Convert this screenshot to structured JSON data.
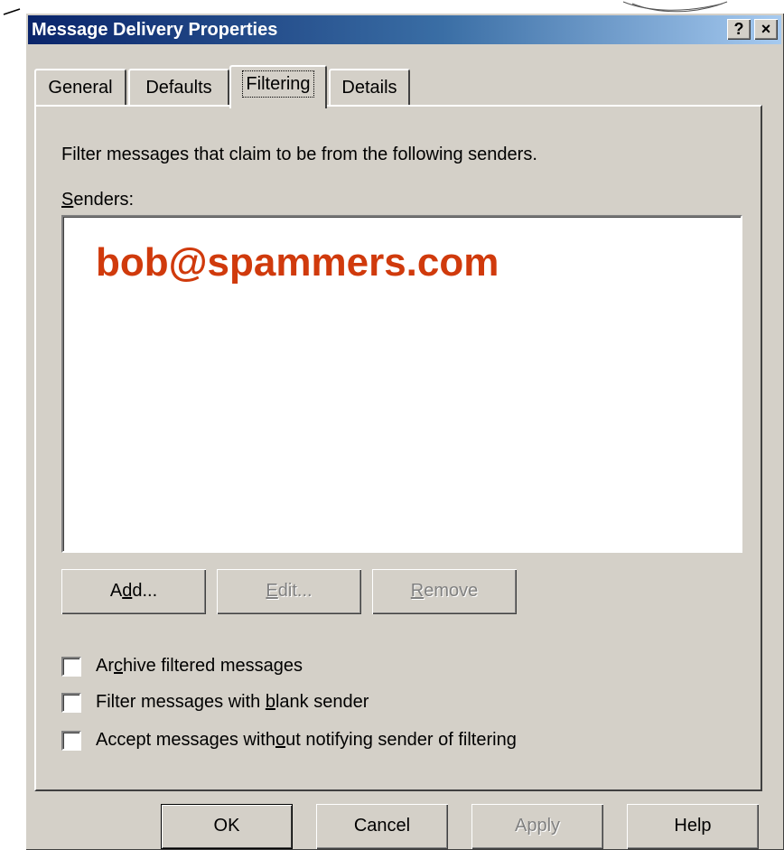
{
  "window": {
    "title": "Message Delivery Properties",
    "help_button": "?",
    "close_button": "×"
  },
  "tabs": [
    {
      "label": "General",
      "active": false
    },
    {
      "label": "Defaults",
      "active": false
    },
    {
      "label": "Filtering",
      "active": true
    },
    {
      "label": "Details",
      "active": false
    }
  ],
  "filtering": {
    "description": "Filter messages that claim to be from the following senders.",
    "senders_label_prefix": "",
    "senders_label_ul": "S",
    "senders_label_rest": "enders:",
    "senders": [
      "bob@spammers.com"
    ],
    "buttons": {
      "add": {
        "pre": "A",
        "ul": "d",
        "post": "d..."
      },
      "edit": {
        "pre": "",
        "ul": "E",
        "post": "dit..."
      },
      "remove": {
        "pre": "",
        "ul": "R",
        "post": "emove"
      }
    },
    "options": [
      {
        "pre": "Ar",
        "ul": "c",
        "post": "hive filtered messages",
        "checked": false
      },
      {
        "pre": "Filter messages with ",
        "ul": "b",
        "post": "lank sender",
        "checked": false
      },
      {
        "pre": "Accept messages with",
        "ul": "o",
        "post": "ut notifying sender of filtering",
        "checked": false
      }
    ]
  },
  "footer": {
    "ok": "OK",
    "cancel": "Cancel",
    "apply": "Apply",
    "help": "Help"
  },
  "colors": {
    "title_start": "#0a246a",
    "title_end": "#a6caf0",
    "sender_highlight": "#d03a0c",
    "dialog_face": "#d4d0c8"
  }
}
